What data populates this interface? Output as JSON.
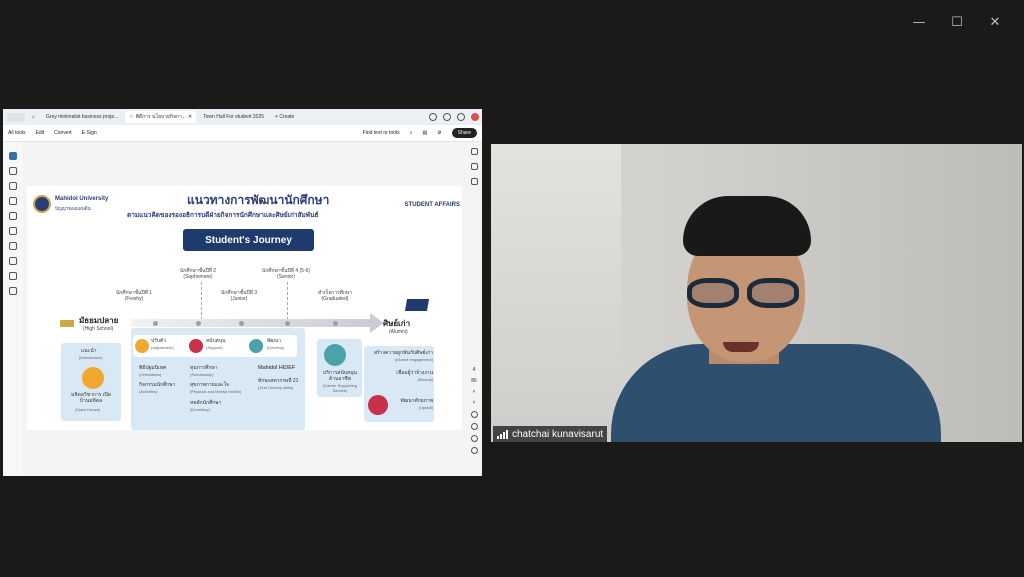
{
  "window": {
    "controls": [
      "—",
      "☐",
      "✕"
    ]
  },
  "browser": {
    "tabs": [
      {
        "label": "Grey minimalist business proje..."
      },
      {
        "label": "พิธีการ นโยบายกิจกา..."
      },
      {
        "label": "Town Hall For student 2025"
      }
    ],
    "create_label": "+ Create"
  },
  "pdf_toolbar": {
    "menu": [
      "All tools",
      "Edit",
      "Convert",
      "E-Sign"
    ],
    "search_label": "Find text or tools",
    "share_label": "Share"
  },
  "page_nav": {
    "current": "4",
    "total": "86"
  },
  "slide": {
    "university": "Mahidol University",
    "university_sub": "ปัญญาของแผ่นดิน",
    "title": "แนวทางการพัฒนานักศึกษา",
    "subtitle": "ตามแนวคิดของรองอธิการบดีฝ่ายกิจการนักศึกษาและศิษย์เก่าสัมพันธ์",
    "badge": "STUDENT AFFAIRS",
    "banner": "Student's Journey",
    "years": [
      {
        "th": "นักศึกษาชั้นปีที่ 1",
        "en": "(Freshy)"
      },
      {
        "th": "นักศึกษาชั้นปีที่ 2",
        "en": "(Sophomore)"
      },
      {
        "th": "นักศึกษาชั้นปีที่ 3",
        "en": "(Junior)"
      },
      {
        "th": "นักศึกษาชั้นปีที่ 4 (5-6)",
        "en": "(Senior)"
      },
      {
        "th": "สำเร็จการศึกษา",
        "en": "(Graduated)"
      }
    ],
    "start": {
      "th": "มัธยมปลาย",
      "en": "(High School)"
    },
    "end": {
      "th": "ศิษย์เก่า",
      "en": "(Alumni)"
    },
    "hs_panel": {
      "intro_th": "แนะนำ",
      "intro_en": "(Introduction)",
      "open_th": "มหิดลวิชาการ เปิดบ้านมหิดล",
      "open_en": "(Open House)"
    },
    "phases": [
      {
        "th": "ปรับตัว",
        "en": "(Adjustment)"
      },
      {
        "th": "สนับสนุน",
        "en": "(Support)"
      },
      {
        "th": "พัฒนา",
        "en": "(Develop)"
      }
    ],
    "main_items": [
      {
        "th": "พิธีปฐมนิเทศ",
        "en": "(Orientation)"
      },
      {
        "th": "กิจกรรมนักศึกษา",
        "en": "(Activities)"
      },
      {
        "th": "ทุนการศึกษา",
        "en": "(Scholarship)"
      },
      {
        "th": "สุขภาพกายและใจ",
        "en": "(Physical and Mental Health)"
      },
      {
        "th": "หอพักนักศึกษา",
        "en": "(Dormitory)"
      },
      {
        "th": "Mahidol HIDEF",
        "en": ""
      },
      {
        "th": "ทักษะศตวรรษที่ 21",
        "en": "(21st Century skills)"
      }
    ],
    "career": {
      "th": "บริการสนับสนุน ด้านอาชีพ",
      "en": "(Career Supporting Service)"
    },
    "alumni_items": [
      {
        "th": "สร้างความผูกพันกับศิษย์เก่า",
        "en": "(Alumni engagement)"
      },
      {
        "th": "เชื่อมผู้ว่าจ้างงาน",
        "en": "(Recruit)"
      },
      {
        "th": "พัฒนาศักยภาพ",
        "en": "(Upskill)"
      }
    ]
  },
  "participant": {
    "name": "chatchai kunavisarut"
  }
}
